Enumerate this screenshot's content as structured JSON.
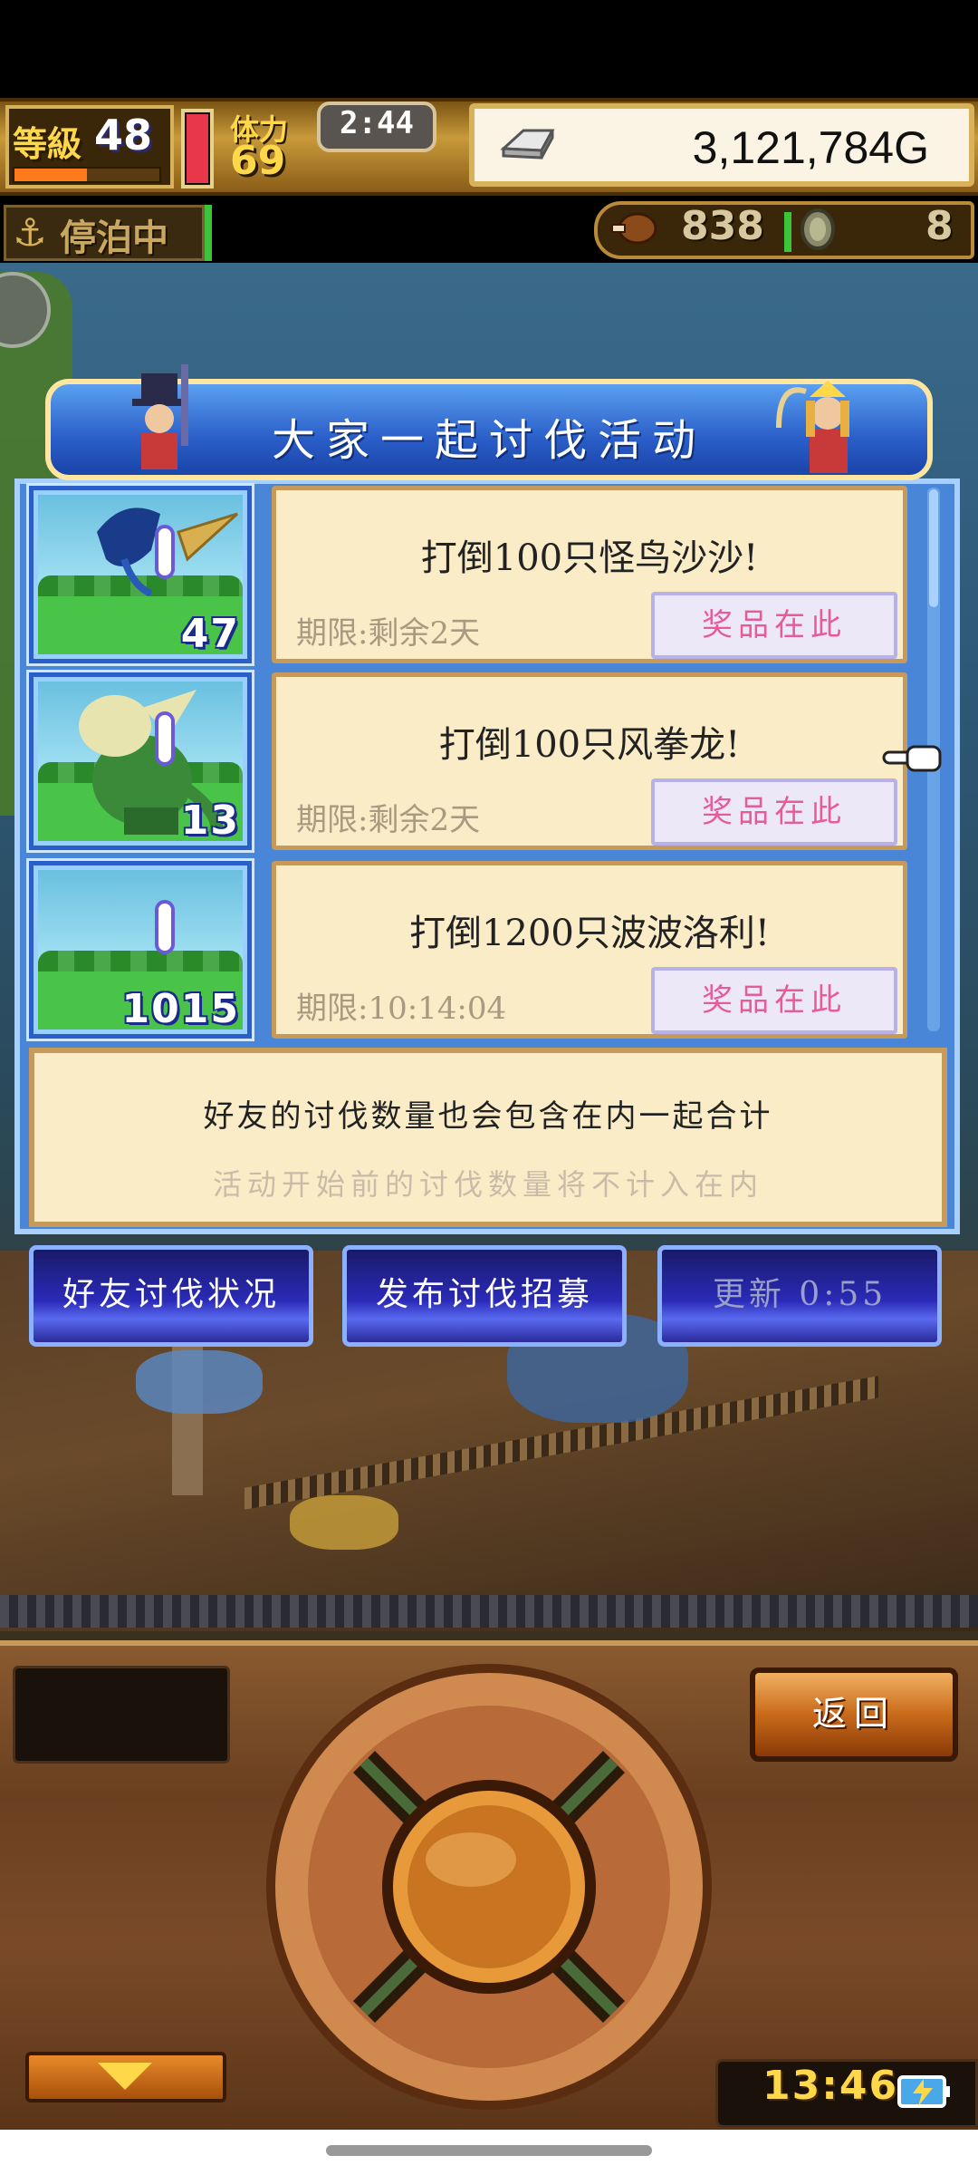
{
  "hud": {
    "level_label": "等級",
    "level": "48",
    "exp_fraction": 0.5,
    "stamina_label": "体力",
    "stamina": "69",
    "timer": "2:44",
    "gold": "3,121,784G"
  },
  "status_row": {
    "docked_label": "停泊中",
    "meat": "838",
    "coins": "8"
  },
  "event": {
    "title": "大家一起讨伐活动",
    "quests": [
      {
        "title": "打倒100只怪鸟沙沙!",
        "deadline": "期限:剩余2天",
        "count": "47",
        "prize_label": "奖品在此"
      },
      {
        "title": "打倒100只风拳龙!",
        "deadline": "期限:剩余2天",
        "count": "13",
        "prize_label": "奖品在此"
      },
      {
        "title": "打倒1200只波波洛利!",
        "deadline": "期限:10:14:04",
        "count": "1015",
        "prize_label": "奖品在此"
      }
    ],
    "note_line1": "好友的讨伐数量也会包含在内一起合计",
    "note_line2": "活动开始前的讨伐数量将不计入在内"
  },
  "buttons": {
    "friend_status": "好友讨伐状况",
    "post_recruit": "发布讨伐招募",
    "refresh": "更新 0:55"
  },
  "controls": {
    "return_label": "返回",
    "clock": "13:46"
  },
  "colors": {
    "panel_blue": "#4a86d8",
    "card_cream": "#fbecc8",
    "prize_pink": "#e85a9a",
    "hud_gold": "#ffd84a"
  }
}
